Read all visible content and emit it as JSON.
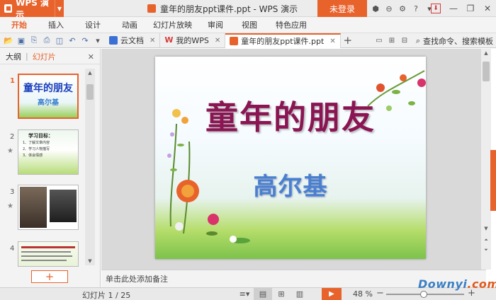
{
  "titlebar": {
    "app_name": "WPS 演示",
    "doc_title": "童年的朋友ppt课件.ppt - WPS 演示",
    "login_label": "未登录"
  },
  "menu": {
    "tabs": [
      {
        "label": "开始",
        "active": true
      },
      {
        "label": "插入"
      },
      {
        "label": "设计"
      },
      {
        "label": "动画"
      },
      {
        "label": "幻灯片放映"
      },
      {
        "label": "审阅"
      },
      {
        "label": "视图"
      },
      {
        "label": "特色应用"
      }
    ]
  },
  "doctabs": {
    "items": [
      {
        "label": "云文档",
        "icon": "cloud-doc-icon",
        "color": "#3b6fd6"
      },
      {
        "label": "我的WPS",
        "icon": "wps-icon",
        "color": "#d63b3b"
      },
      {
        "label": "童年的朋友ppt课件.ppt",
        "icon": "ppt-file-icon",
        "color": "#e8622c",
        "active": true
      }
    ],
    "search_label": "查找命令、搜索模板"
  },
  "leftpane": {
    "tab_outline": "大纲",
    "tab_slides": "幻灯片",
    "slides": [
      {
        "num": "1",
        "title": "童年的朋友",
        "sub": "高尔基"
      },
      {
        "num": "2",
        "title": "学习目标：",
        "bullets": [
          "1、了解文章内容",
          "2、学习人物描写",
          "3、体会情感"
        ]
      },
      {
        "num": "3"
      },
      {
        "num": "4"
      }
    ]
  },
  "slide": {
    "title": "童年的朋友",
    "subtitle": "高尔基"
  },
  "notes": {
    "placeholder": "单击此处添加备注"
  },
  "status": {
    "slide_counter": "幻灯片 1 / 25",
    "zoom": "48 %",
    "zoom_level": 0.48
  },
  "watermark": {
    "text_a": "Downyi",
    "text_b": ".com"
  },
  "colors": {
    "accent": "#e8622c",
    "title": "#8a1552",
    "subtitle": "#4a7fd0"
  }
}
